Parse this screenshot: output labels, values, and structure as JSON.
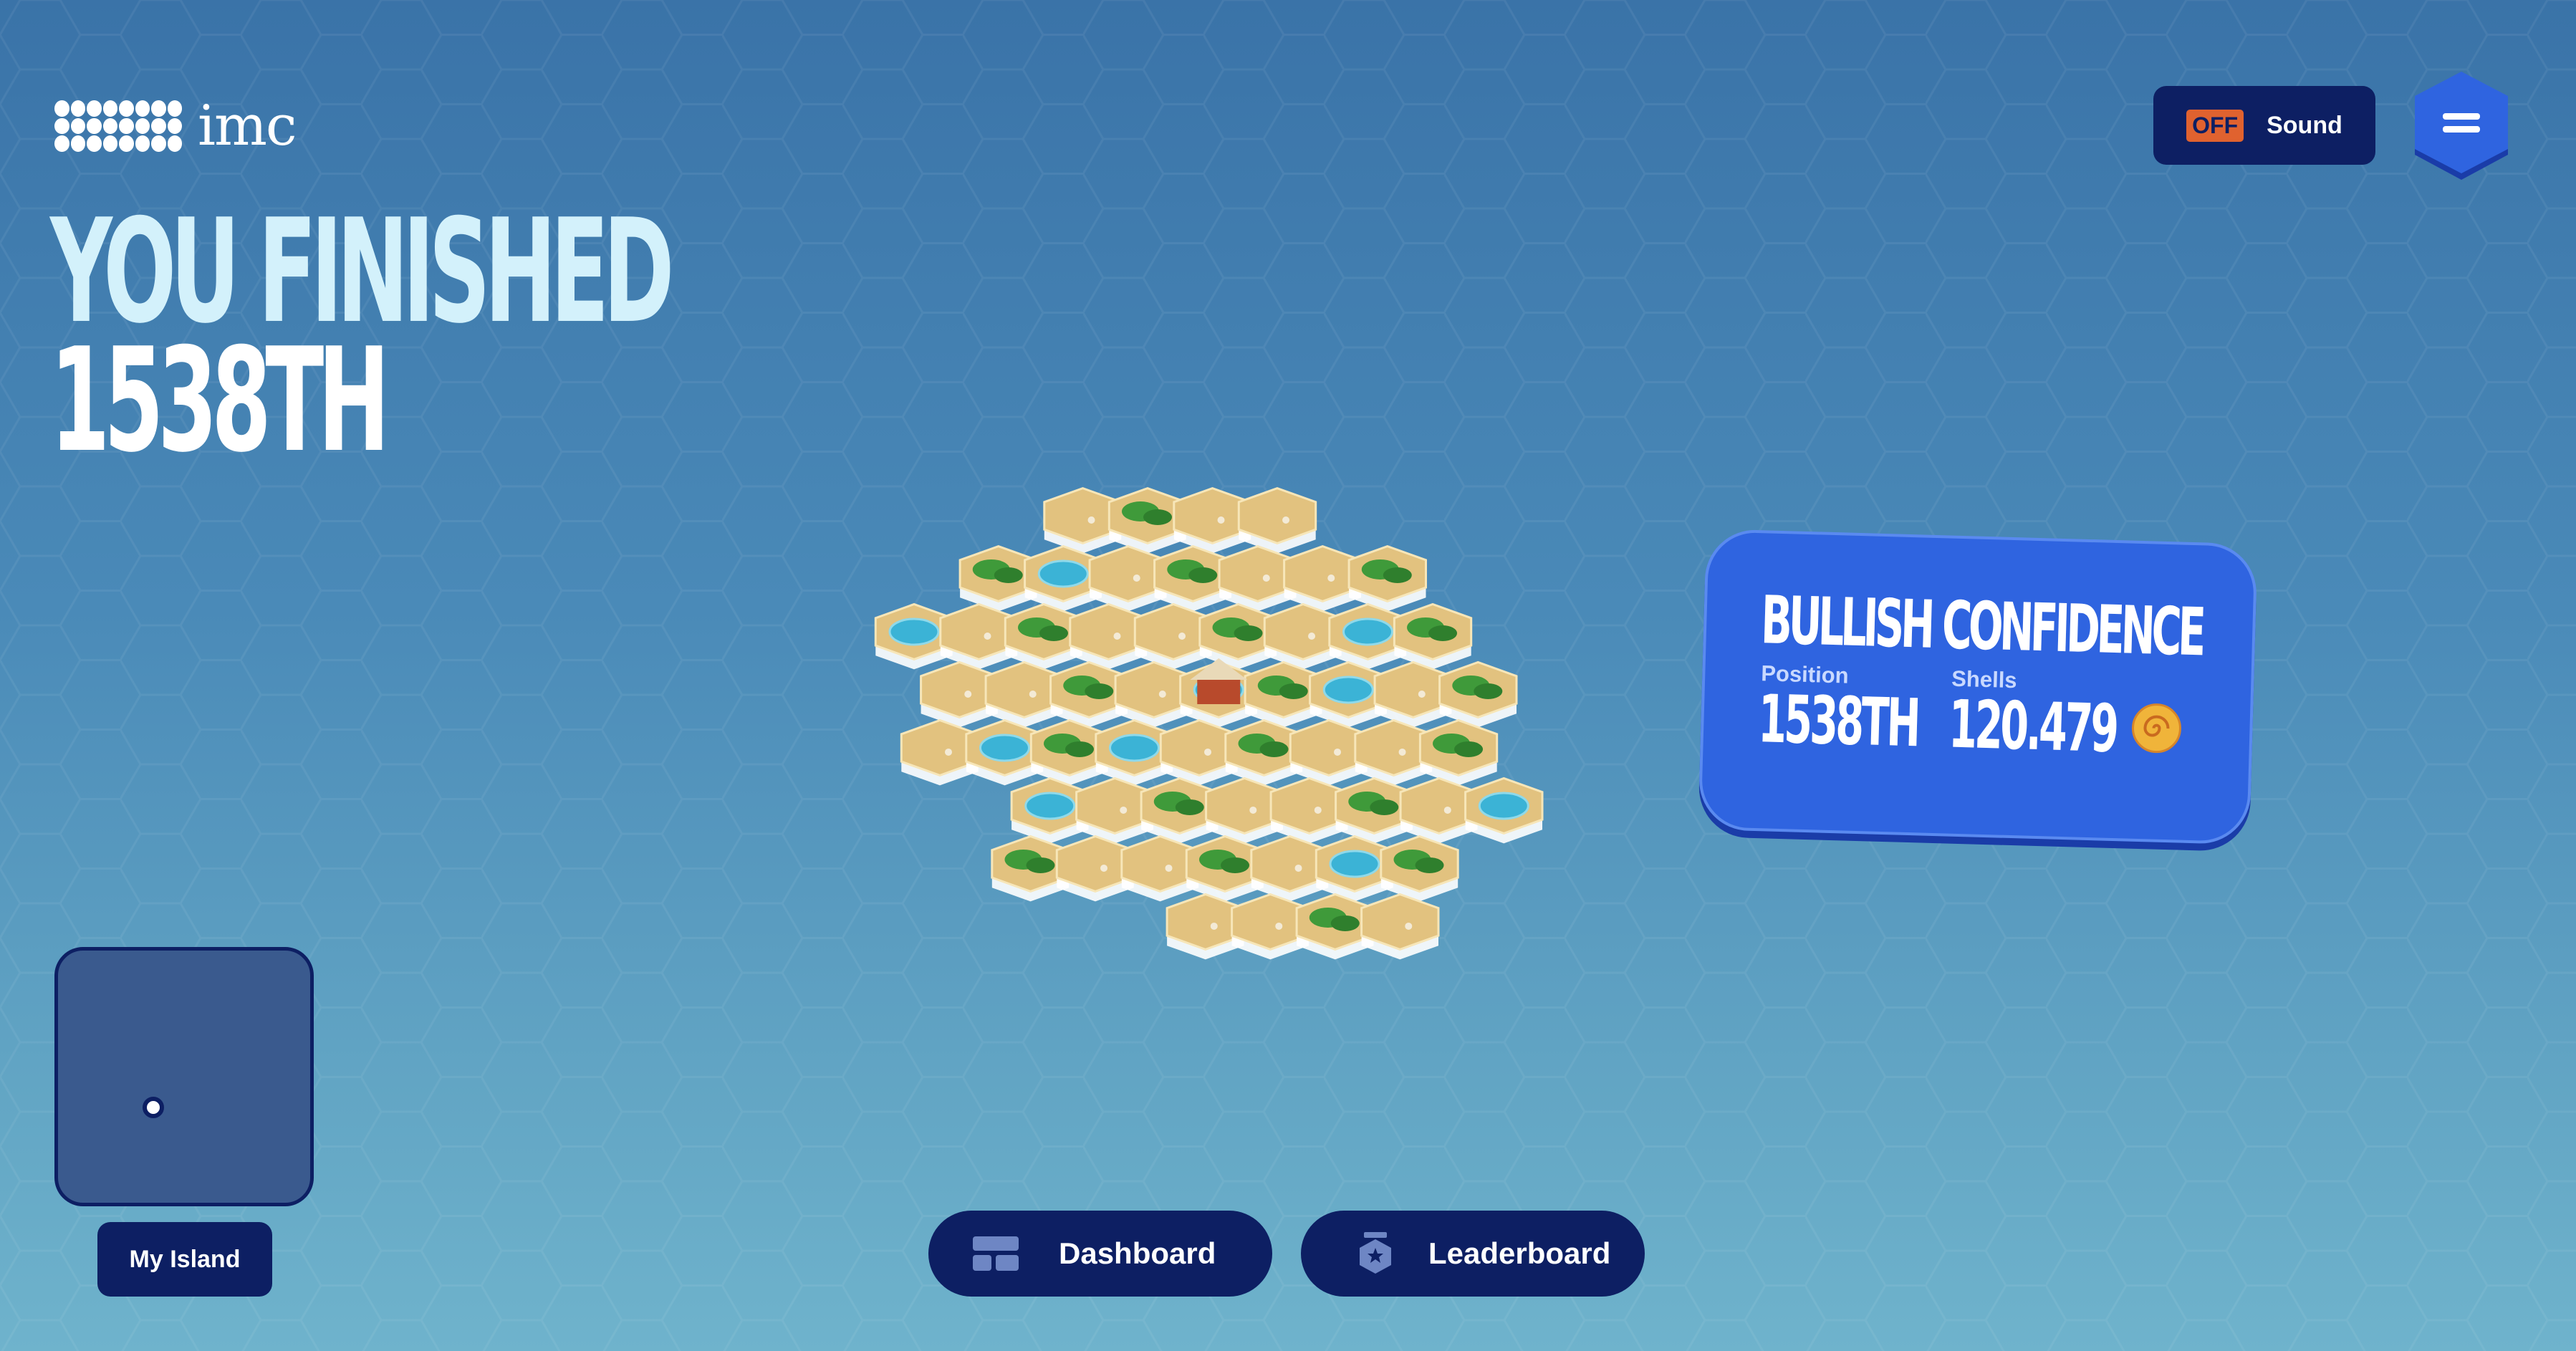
{
  "brand": {
    "logo_text": "imc",
    "logo_icon": "dot-grid-logo-icon"
  },
  "headline": {
    "line1": "YOU FINISHED",
    "line2": "1538TH"
  },
  "sound": {
    "state": "OFF",
    "label": "Sound"
  },
  "menu": {
    "icon": "hamburger-menu-icon"
  },
  "result_card": {
    "title": "BULLISH CONFIDENCE",
    "position_label": "Position",
    "position_value": "1538TH",
    "shells_label": "Shells",
    "shells_value": "120.479",
    "shells_icon": "shell-icon"
  },
  "minimap": {
    "button_label": "My Island"
  },
  "bottom_nav": {
    "dashboard_label": "Dashboard",
    "dashboard_icon": "dashboard-icon",
    "leaderboard_label": "Leaderboard",
    "leaderboard_icon": "medal-icon"
  },
  "colors": {
    "navy": "#0d1f63",
    "card_blue": "#2f64e0",
    "accent_orange": "#e0622f",
    "headline_light": "#d3f1fb",
    "sand": "#e2c27f",
    "water": "#3bb3d6",
    "palm": "#3f9a3a"
  }
}
